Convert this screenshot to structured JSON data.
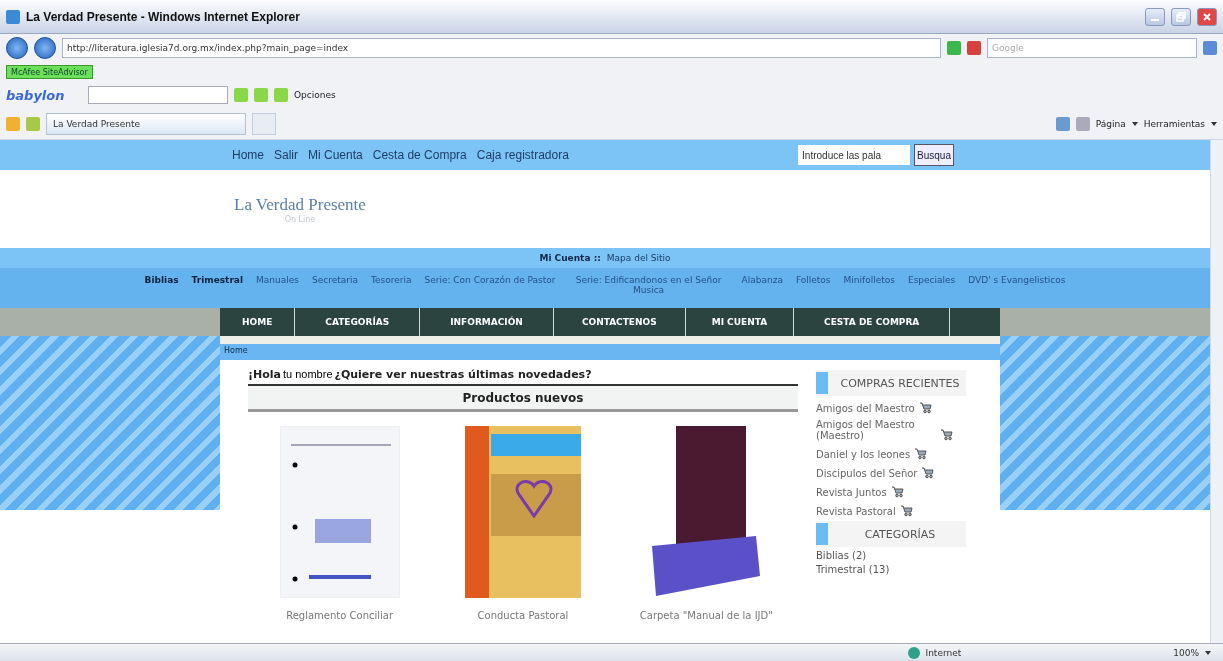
{
  "window": {
    "title": "La Verdad Presente - Windows Internet Explorer"
  },
  "address_bar": {
    "url": "http://literatura.iglesia7d.org.mx/index.php?main_page=index",
    "search_placeholder": "Google"
  },
  "mcafee": {
    "label": "McAfee SiteAdvisor"
  },
  "babylon": {
    "logo": "babylon",
    "options": "Opciones"
  },
  "favorites_bar": {
    "tab": "La Verdad Presente",
    "page_menu": "Página",
    "tools_menu": "Herramientas"
  },
  "top_nav": {
    "links": [
      "Home",
      "Salir",
      "Mi Cuenta",
      "Cesta de Compra",
      "Caja registradora"
    ],
    "search_value": "Introduce las pala",
    "search_button": "Busqua"
  },
  "logo": {
    "text": "La Verdad Presente",
    "tagline": "On Line"
  },
  "account_bar": {
    "account": "Mi Cuenta ::",
    "sitemap": "Mapa del Sitio"
  },
  "categories": [
    {
      "label": "Biblias",
      "bold": true
    },
    {
      "label": "Trimestral",
      "bold": true
    },
    {
      "label": "Manuales",
      "bold": false
    },
    {
      "label": "Secretaria",
      "bold": false
    },
    {
      "label": "Tesoreria",
      "bold": false
    },
    {
      "label": "Serie: Con Corazón de Pastor",
      "bold": false
    },
    {
      "label": "Serie: Edificandonos en el Señor Musica",
      "bold": false
    },
    {
      "label": "Alabanza",
      "bold": false
    },
    {
      "label": "Folletos",
      "bold": false
    },
    {
      "label": "Minifolletos",
      "bold": false
    },
    {
      "label": "Especiales",
      "bold": false
    },
    {
      "label": "DVD' s Evangelisticos",
      "bold": false
    }
  ],
  "main_menu": [
    "HOME",
    "CATEGORÍAS",
    "INFORMACIÓN",
    "CONTACTENOS",
    "MI CUENTA",
    "CESTA DE COMPRA"
  ],
  "breadcrumb": "Home",
  "greeting": {
    "hello": "¡Hola",
    "name": "tu nombre",
    "question": "¿Quiere ver nuestras últimas novedades?"
  },
  "new_products": {
    "title": "Productos nuevos",
    "items": [
      {
        "name": "Reglamento Conciliar",
        "kind": "document"
      },
      {
        "name": "Conducta Pastoral",
        "kind": "book"
      },
      {
        "name": "Carpeta \"Manual de la IJD\"",
        "kind": "box"
      }
    ]
  },
  "recent_purchases": {
    "title": "COMPRAS RECIENTES",
    "items": [
      "Amigos del Maestro",
      "Amigos del Maestro (Maestro)",
      "Daniel y los leones",
      "Discipulos del Señor",
      "Revista Juntos",
      "Revista Pastoral"
    ]
  },
  "sidebar_categories": {
    "title": "CATEGORÍAS",
    "items": [
      "Biblias (2)",
      "Trimestral (13)"
    ]
  },
  "status_bar": {
    "zone": "Internet",
    "zoom": "100%"
  }
}
